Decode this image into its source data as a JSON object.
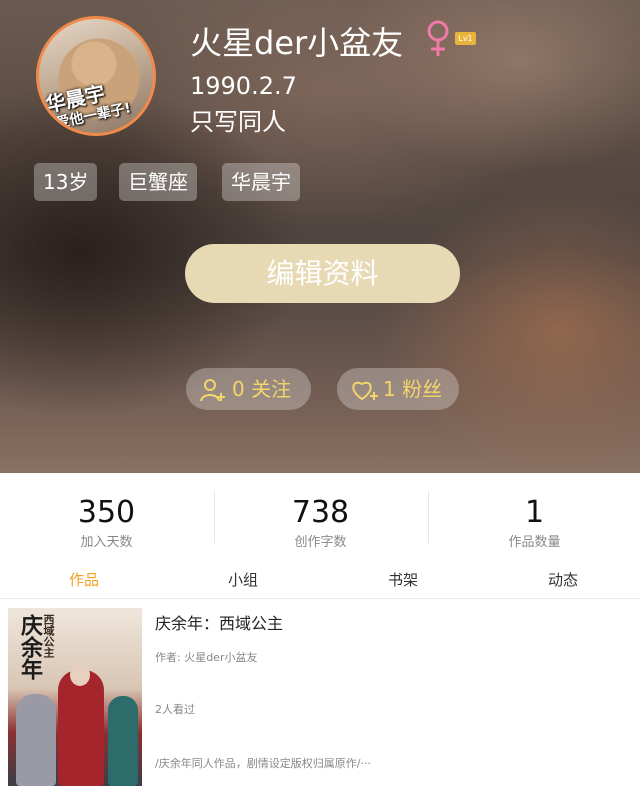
{
  "profile": {
    "avatar_caption_line1": "华晨宇",
    "avatar_caption_line2": "爱他一辈子!",
    "username": "火星der小盆友",
    "gender_symbol": "♀",
    "level": "Lv1",
    "birthday": "1990.2.7",
    "bio": "只写同人",
    "tags": [
      "13岁",
      "巨蟹座",
      "华晨宇"
    ]
  },
  "actions": {
    "edit_label": "编辑资料",
    "following_label": "0 关注",
    "followers_label": "1 粉丝"
  },
  "stats": [
    {
      "value": "350",
      "label": "加入天数"
    },
    {
      "value": "738",
      "label": "创作字数"
    },
    {
      "value": "1",
      "label": "作品数量"
    }
  ],
  "tabs": [
    {
      "label": "作品",
      "active": true
    },
    {
      "label": "小组",
      "active": false
    },
    {
      "label": "书架",
      "active": false
    },
    {
      "label": "动态",
      "active": false
    }
  ],
  "works": [
    {
      "cover_title": "庆余年",
      "cover_subtitle": "西域公主",
      "title": "庆余年：西域公主",
      "author": "作者: 火星der小盆友",
      "views": "2人看过",
      "description": "/庆余年同人作品，剧情设定版权归属原作/···"
    }
  ],
  "colors": {
    "accent_tab": "#f0a020",
    "edit_button": "#e6d9b4",
    "follow_text": "#f3d66b",
    "gender_icon": "#f07aa8",
    "level_badge": "#e8b43a"
  },
  "icons": {
    "gender": "female-symbol-icon",
    "following": "person-add-icon",
    "followers": "heart-add-icon"
  }
}
